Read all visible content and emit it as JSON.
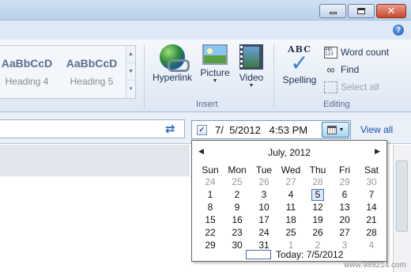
{
  "window": {
    "caption_buttons": [
      {
        "name": "minimize",
        "icon": "minimize-icon"
      },
      {
        "name": "maximize",
        "icon": "restore-icon"
      },
      {
        "name": "close",
        "icon": "close-icon",
        "glyph": "✕"
      }
    ],
    "help_glyph": "?"
  },
  "ribbon": {
    "styles": [
      {
        "sample": "AaBbCcD",
        "name": "Heading 4"
      },
      {
        "sample": "AaBbCcD",
        "name": "Heading 5"
      }
    ],
    "insert": {
      "label": "Insert",
      "buttons": [
        {
          "label": "Hyperlink",
          "icon": "globe-link-icon"
        },
        {
          "label": "Picture",
          "icon": "picture-icon"
        },
        {
          "label": "Video",
          "icon": "video-icon"
        }
      ]
    },
    "editing": {
      "label": "Editing",
      "spelling": {
        "top": "ABC",
        "label": "Spelling",
        "check": "✓"
      },
      "word_count": {
        "label": "Word count",
        "icon_text": "ABC 123"
      },
      "find": {
        "label": "Find",
        "icon": "binoculars-icon"
      },
      "select_all": {
        "label": "Select all"
      }
    }
  },
  "toolbar": {
    "sync_glyph": "⇄",
    "datetime": {
      "checked": "✓",
      "value": "7/  5/2012   4:53 PM"
    },
    "view_all": "View all"
  },
  "calendar": {
    "prev": "◀",
    "next": "▶",
    "month": "July, 2012",
    "weekdays": [
      "Sun",
      "Mon",
      "Tue",
      "Wed",
      "Thu",
      "Fri",
      "Sat"
    ],
    "weeks": [
      [
        "24",
        "25",
        "26",
        "27",
        "28",
        "29",
        "30"
      ],
      [
        "1",
        "2",
        "3",
        "4",
        "5",
        "6",
        "7"
      ],
      [
        "8",
        "9",
        "10",
        "11",
        "12",
        "13",
        "14"
      ],
      [
        "15",
        "16",
        "17",
        "18",
        "19",
        "20",
        "21"
      ],
      [
        "22",
        "23",
        "24",
        "25",
        "26",
        "27",
        "28"
      ],
      [
        "29",
        "30",
        "31",
        "1",
        "2",
        "3",
        "4"
      ]
    ],
    "selected": "5",
    "today_label": "Today: 7/5/2012"
  },
  "watermark": "www.989214.com",
  "colors": {
    "accent": "#1a4ea8",
    "ribbon": "#dde7f3",
    "close": "#c9492e"
  }
}
